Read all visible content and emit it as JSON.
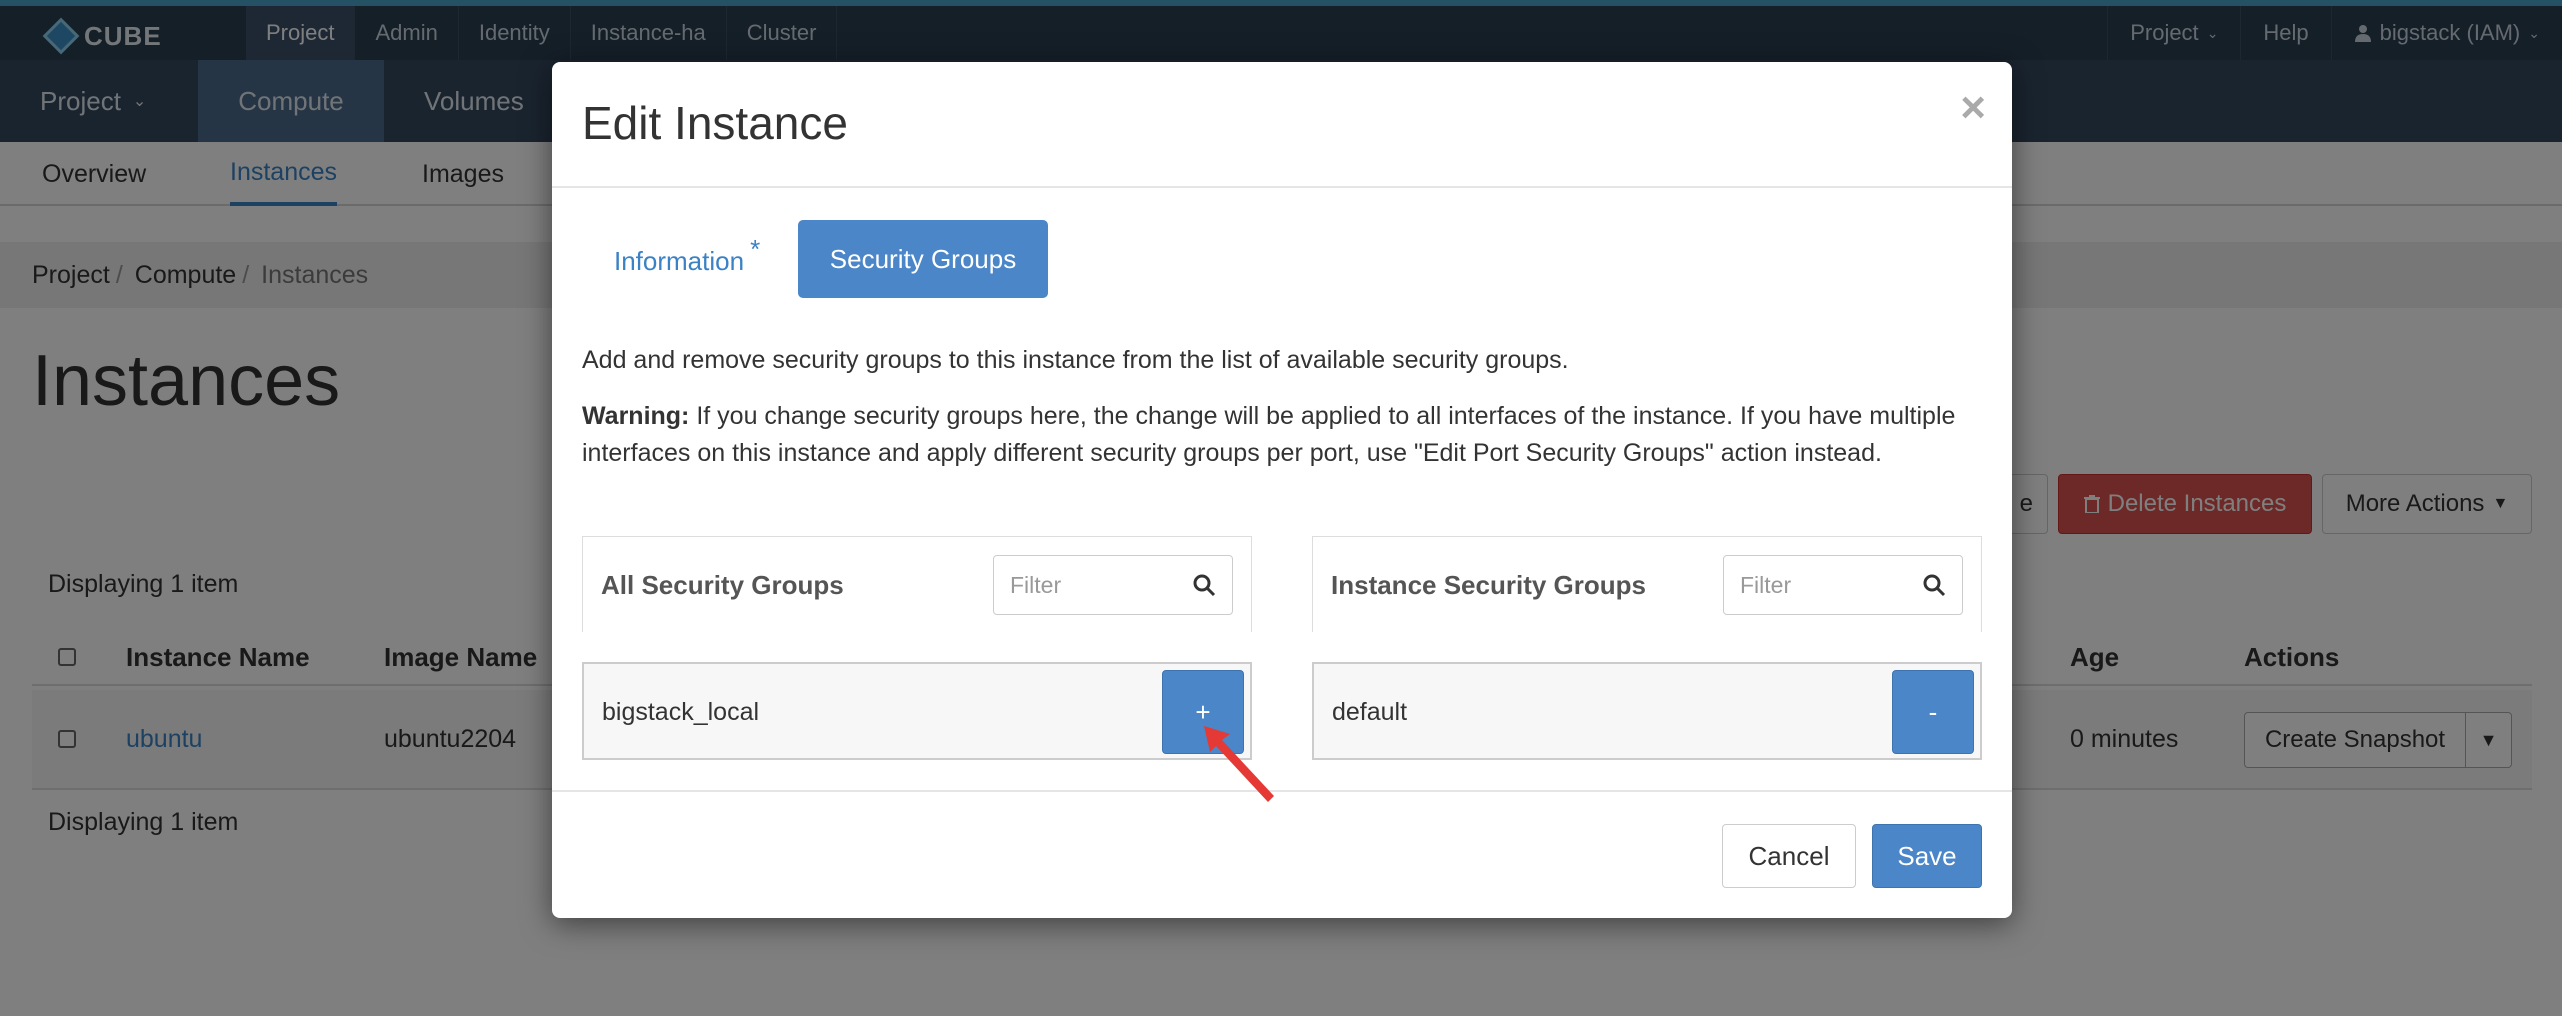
{
  "brand": {
    "name": "CUBE"
  },
  "topnav": {
    "items": [
      "Project",
      "Admin",
      "Identity",
      "Instance-ha",
      "Cluster"
    ],
    "right": {
      "project": "Project",
      "help": "Help",
      "user": "bigstack (IAM)"
    }
  },
  "subnav": {
    "project": "Project",
    "compute": "Compute",
    "volumes": "Volumes"
  },
  "tabs": [
    "Overview",
    "Instances",
    "Images"
  ],
  "breadcrumb": {
    "project": "Project",
    "compute": "Compute",
    "instances": "Instances"
  },
  "page": {
    "title": "Instances",
    "delete_button": "Delete Instances",
    "more_actions": "More Actions",
    "partial_button": "e",
    "displaying_top": "Displaying 1 item",
    "displaying_bottom": "Displaying 1 item"
  },
  "table": {
    "headers": {
      "name": "Instance Name",
      "image": "Image Name",
      "age": "Age",
      "actions": "Actions"
    },
    "rows": [
      {
        "name": "ubuntu",
        "image": "ubuntu2204",
        "age": "0 minutes",
        "action": "Create Snapshot"
      }
    ]
  },
  "modal": {
    "title": "Edit Instance",
    "close": "×",
    "tabs": {
      "information": "Information",
      "required_marker": "*",
      "security_groups": "Security Groups"
    },
    "description": "Add and remove security groups to this instance from the list of available security groups.",
    "warning_label": "Warning:",
    "warning_text": " If you change security groups here, the change will be applied to all interfaces of the instance. If you have multiple interfaces on this instance and apply different security groups per port, use \"Edit Port Security Groups\" action instead.",
    "all_groups": {
      "title": "All Security Groups",
      "filter_placeholder": "Filter",
      "items": [
        {
          "name": "bigstack_local",
          "button": "+"
        }
      ]
    },
    "instance_groups": {
      "title": "Instance Security Groups",
      "filter_placeholder": "Filter",
      "items": [
        {
          "name": "default",
          "button": "-"
        }
      ]
    },
    "footer": {
      "cancel": "Cancel",
      "save": "Save"
    }
  },
  "colors": {
    "topbar": "#2b3e50",
    "primary": "#4a86c8",
    "danger": "#d9534f",
    "link": "#3b82c4",
    "pointer": "#e53935"
  }
}
